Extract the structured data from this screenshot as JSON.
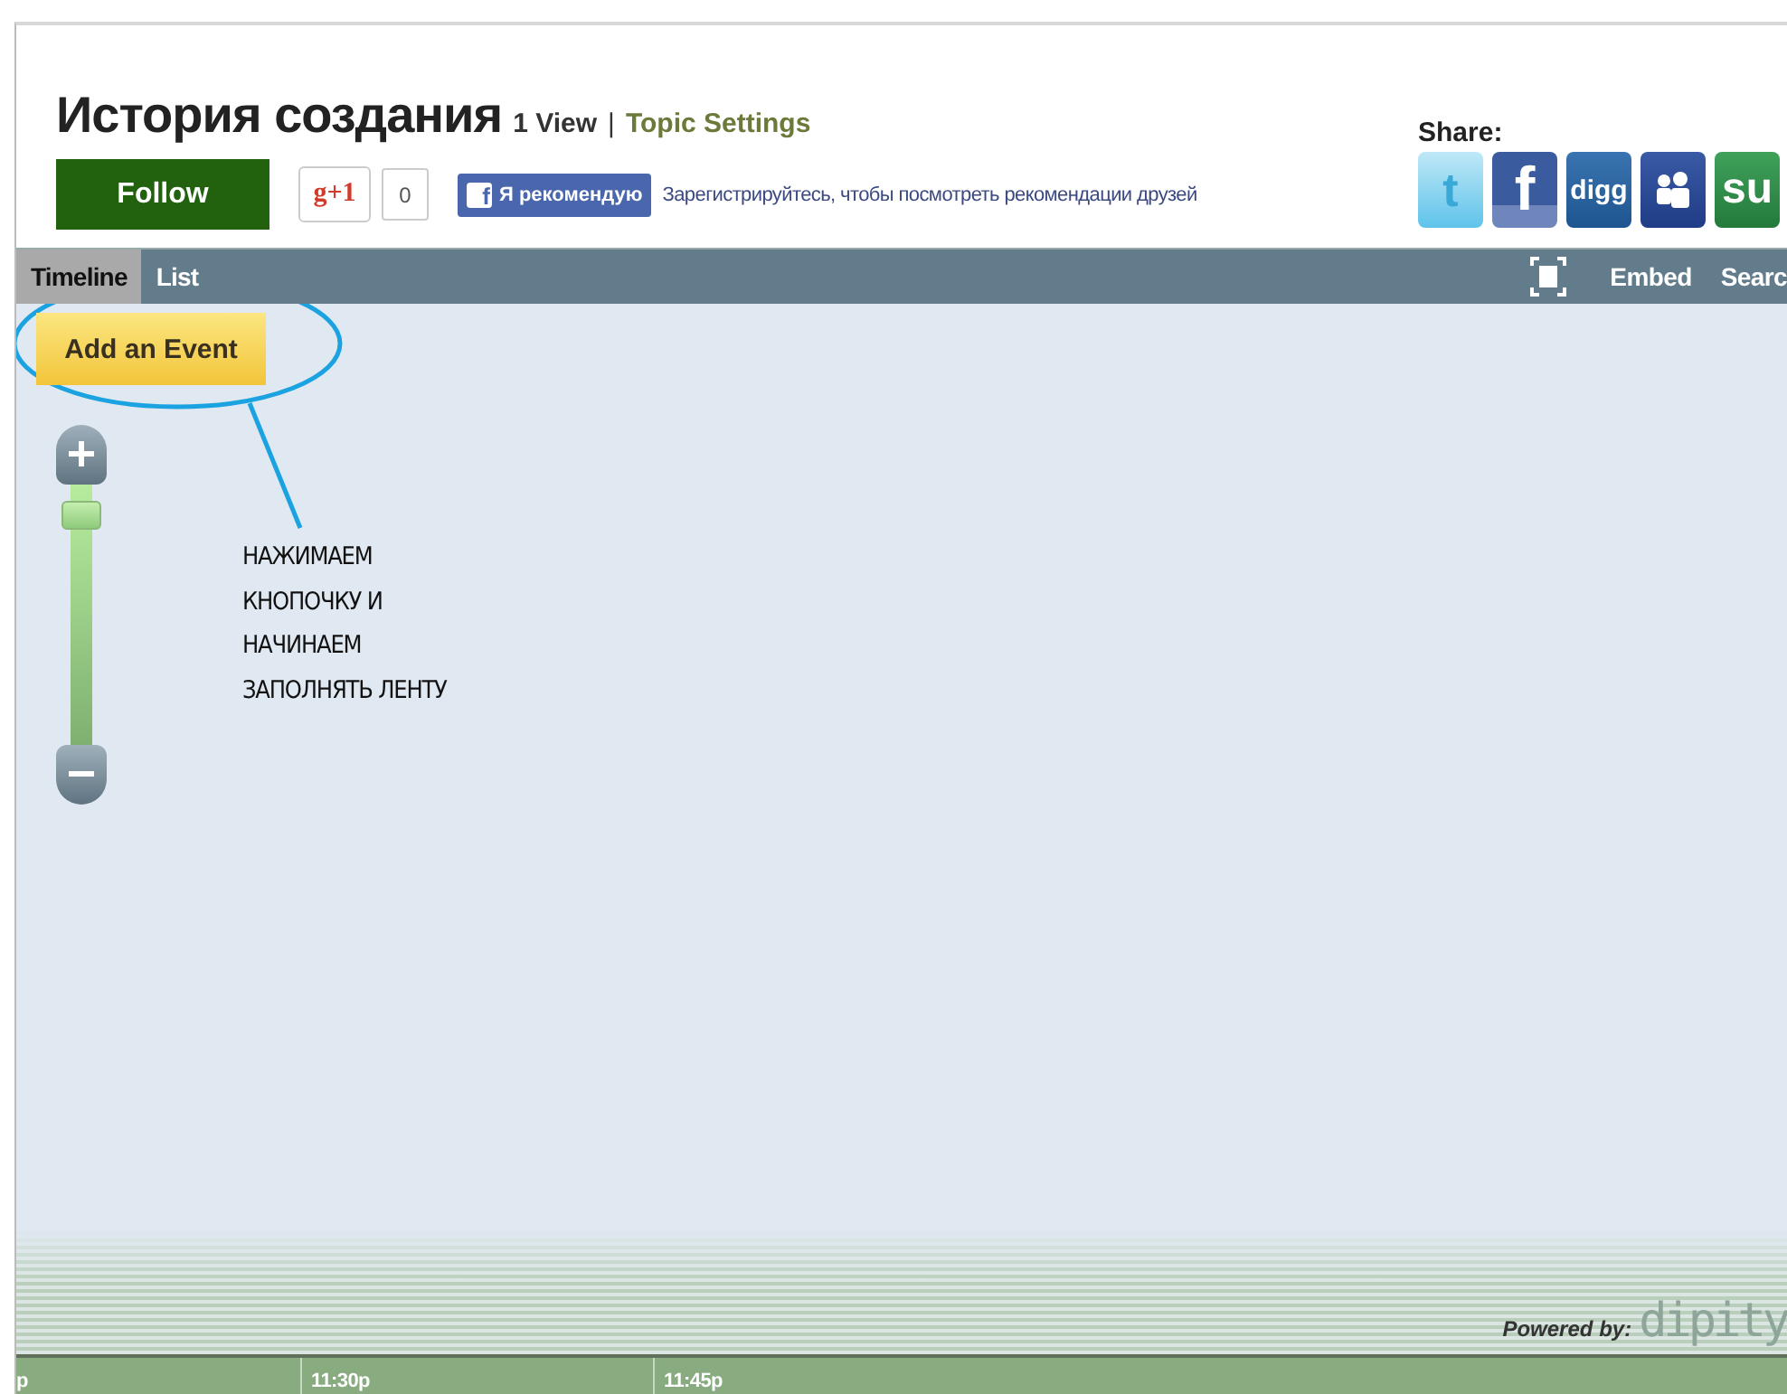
{
  "header": {
    "title": "История создания",
    "views": "1 View",
    "separator": "|",
    "settings_link": "Topic Settings",
    "follow_button": "Follow",
    "plus_one": {
      "label": "g+1",
      "count": "0"
    },
    "recommend": {
      "icon": "f",
      "label": "Я рекомендую",
      "note": "Зарегистрируйтесь, чтобы посмотреть рекомендации друзей"
    },
    "share": {
      "label": "Share:",
      "items": [
        {
          "kind": "twitter",
          "glyph": "t"
        },
        {
          "kind": "facebook",
          "glyph": "f"
        },
        {
          "kind": "digg",
          "glyph": "digg"
        },
        {
          "kind": "myspace"
        },
        {
          "kind": "stumbleupon",
          "glyph": "su"
        }
      ]
    }
  },
  "toolbar": {
    "tabs": [
      {
        "label": "Timeline",
        "selected": true
      },
      {
        "label": "List",
        "selected": false
      }
    ],
    "actions": [
      "Embed",
      "Searc"
    ]
  },
  "canvas": {
    "add_button": "Add an Event",
    "zoom": {
      "level": 0.93
    },
    "annotation": {
      "lines": [
        "НАЖИМАЕМ",
        "КНОПОЧКУ И",
        "НАЧИНАЕМ",
        "ЗАПОЛНЯТЬ ЛЕНТУ"
      ]
    },
    "powered_by": "Powered by:",
    "brand": "dipity"
  },
  "axis": {
    "ticks": [
      "p",
      "11:30p",
      "11:45p"
    ]
  }
}
